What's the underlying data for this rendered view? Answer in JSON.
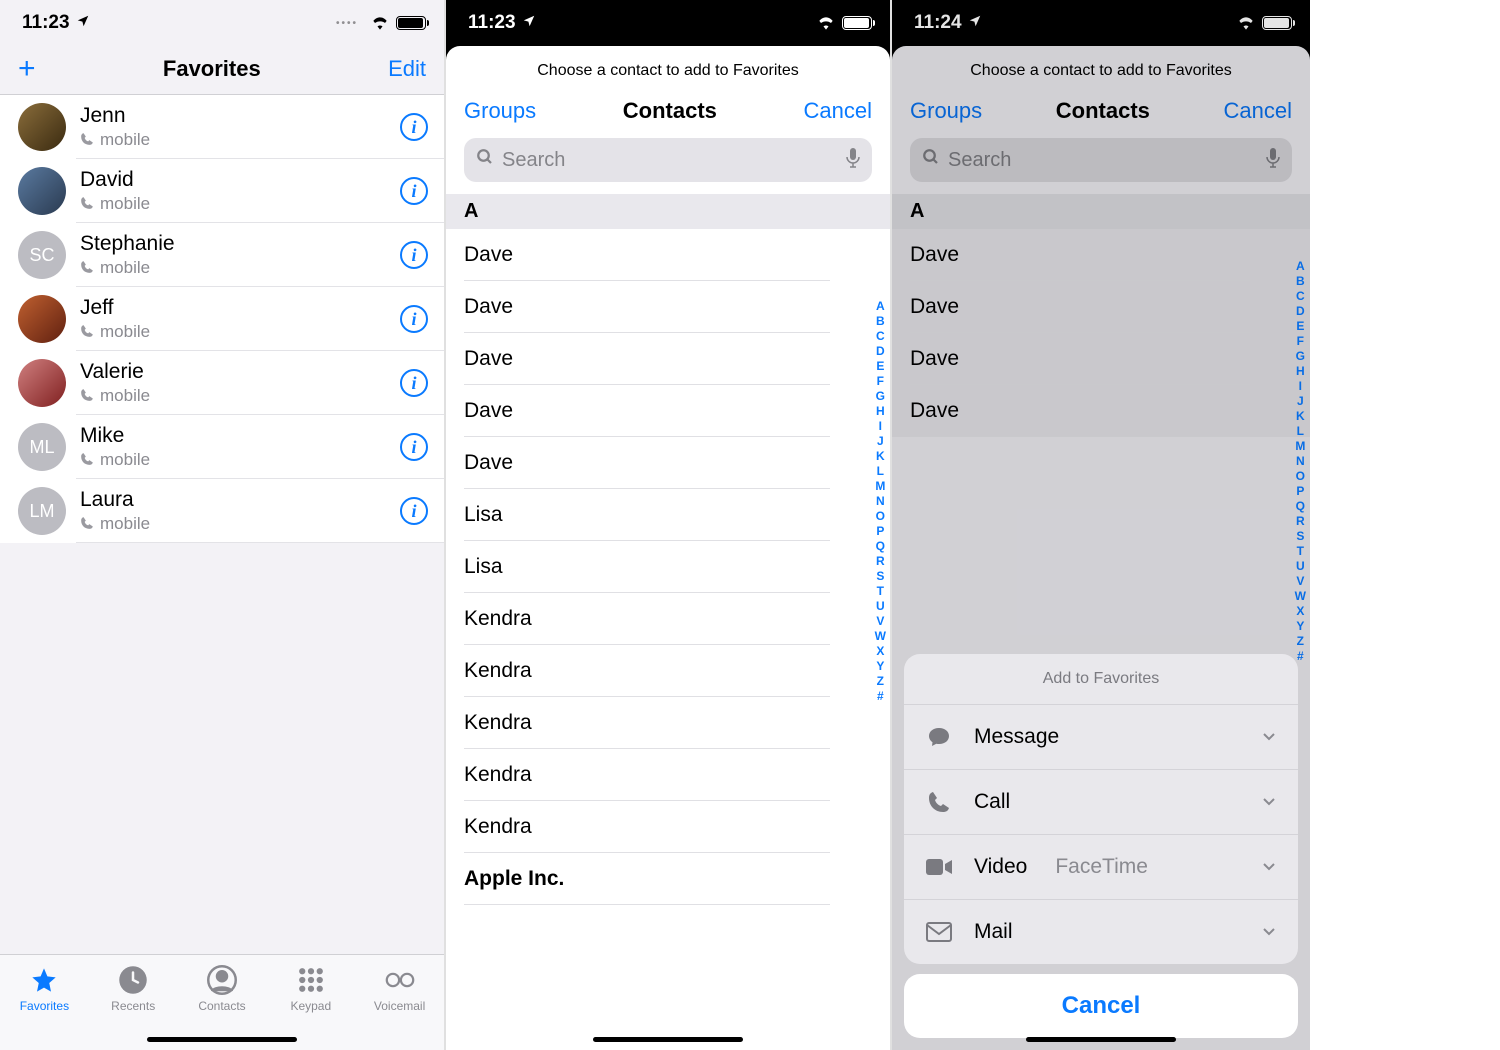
{
  "status": {
    "time1": "11:23",
    "time2": "11:23",
    "time3": "11:24"
  },
  "screen1": {
    "title": "Favorites",
    "edit": "Edit",
    "favorites": [
      {
        "name": "Jenn",
        "sub": "mobile",
        "initials": "",
        "photo": "av-photo1"
      },
      {
        "name": "David",
        "sub": "mobile",
        "initials": "",
        "photo": "av-photo2"
      },
      {
        "name": "Stephanie",
        "sub": "mobile",
        "initials": "SC",
        "photo": ""
      },
      {
        "name": "Jeff",
        "sub": "mobile",
        "initials": "",
        "photo": "av-photo4"
      },
      {
        "name": "Valerie",
        "sub": "mobile",
        "initials": "",
        "photo": "av-photo5"
      },
      {
        "name": "Mike",
        "sub": "mobile",
        "initials": "ML",
        "photo": ""
      },
      {
        "name": "Laura",
        "sub": "mobile",
        "initials": "LM",
        "photo": ""
      }
    ],
    "tabs": [
      {
        "label": "Favorites",
        "active": true
      },
      {
        "label": "Recents",
        "active": false
      },
      {
        "label": "Contacts",
        "active": false
      },
      {
        "label": "Keypad",
        "active": false
      },
      {
        "label": "Voicemail",
        "active": false
      }
    ]
  },
  "picker": {
    "header": "Choose a contact to add to Favorites",
    "groups": "Groups",
    "title": "Contacts",
    "cancel": "Cancel",
    "search_placeholder": "Search",
    "section": "A",
    "contacts": [
      "Dave",
      "Dave",
      "Dave",
      "Dave",
      "Dave",
      "Lisa",
      "Lisa",
      "Kendra",
      "Kendra",
      "Kendra",
      "Kendra",
      "Kendra"
    ],
    "bold_row": "Apple Inc.",
    "index": [
      "A",
      "B",
      "C",
      "D",
      "E",
      "F",
      "G",
      "H",
      "I",
      "J",
      "K",
      "L",
      "M",
      "N",
      "O",
      "P",
      "Q",
      "R",
      "S",
      "T",
      "U",
      "V",
      "W",
      "X",
      "Y",
      "Z",
      "#"
    ]
  },
  "picker3_contacts": [
    "Dave",
    "Dave",
    "Dave",
    "Dave"
  ],
  "actionsheet": {
    "title": "Add to Favorites",
    "rows": [
      {
        "label": "Message",
        "sub": ""
      },
      {
        "label": "Call",
        "sub": ""
      },
      {
        "label": "Video",
        "sub": "FaceTime"
      },
      {
        "label": "Mail",
        "sub": ""
      }
    ],
    "cancel": "Cancel"
  }
}
